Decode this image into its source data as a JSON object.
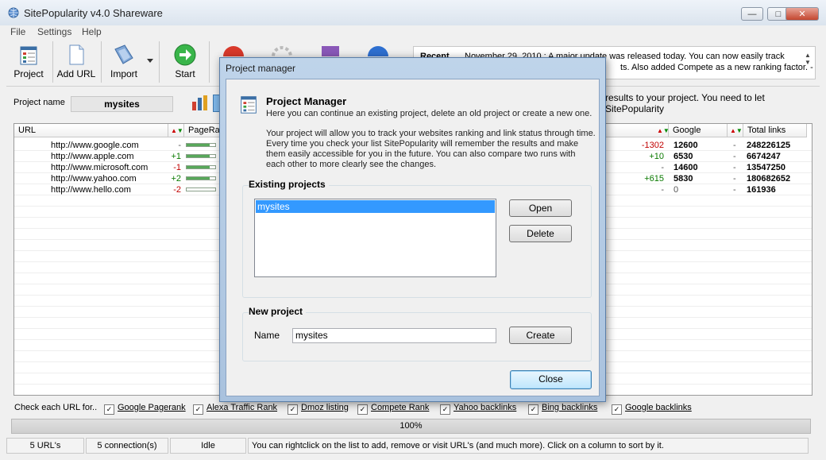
{
  "window": {
    "title": "SitePopularity v4.0 Shareware"
  },
  "menu": [
    "File",
    "Settings",
    "Help"
  ],
  "toolbar": {
    "project": "Project",
    "add_url": "Add URL",
    "import": "Import",
    "start": "Start"
  },
  "recent": {
    "label": "Recent",
    "line1": "November 29, 2010 : A major update was released today. You can now easily track",
    "line2": "ts. Also added Compete as a new ranking factor. -"
  },
  "project_row": {
    "label": "Project name",
    "value": "mysites",
    "hint": "results to your project. You need to let SitePopularity"
  },
  "grid": {
    "headers": {
      "url": "URL",
      "pagerank": "PageRa",
      "google": "Google",
      "total_links": "Total links"
    },
    "rows": [
      {
        "url": "http://www.google.com",
        "pr_change": "-",
        "pr_level": 0.8,
        "g_change": "-1302",
        "google": "12600",
        "tl_change": "-",
        "total_links": "248226125"
      },
      {
        "url": "http://www.apple.com",
        "pr_change": "+1",
        "pr_level": 0.8,
        "g_change": "+10",
        "google": "6530",
        "tl_change": "-",
        "total_links": "6674247"
      },
      {
        "url": "http://www.microsoft.com",
        "pr_change": "-1",
        "pr_level": 0.8,
        "g_change": "-",
        "google": "14600",
        "tl_change": "-",
        "total_links": "13547250"
      },
      {
        "url": "http://www.yahoo.com",
        "pr_change": "+2",
        "pr_level": 0.8,
        "g_change": "+615",
        "google": "5830",
        "tl_change": "-",
        "total_links": "180682652"
      },
      {
        "url": "http://www.hello.com",
        "pr_change": "-2",
        "pr_level": 0.0,
        "g_change": "-",
        "google": "0",
        "tl_change": "-",
        "total_links": "161936"
      }
    ]
  },
  "checks": {
    "label": "Check each URL for..",
    "items": [
      "Google Pagerank",
      "Alexa Traffic Rank",
      "Dmoz listing",
      "Compete Rank",
      "Yahoo backlinks",
      "Bing backlinks",
      "Google backlinks"
    ]
  },
  "progress": {
    "value": 1.0,
    "text": "100%"
  },
  "status": {
    "urls": "5 URL's",
    "connections": "5 connection(s)",
    "state": "Idle",
    "message": "You can rightclick on the list to add, remove or visit URL's (and much more). Click on a column to sort by it."
  },
  "modal": {
    "title": "Project manager",
    "heading": "Project Manager",
    "subheading": "Here you can continue an existing project, delete an old project or create a new one.",
    "description": "Your project will allow you to track your websites ranking and link status through time. Every time you check your list SitePopularity will remember the results and make them easily accessible for you in the future. You can also compare two runs with each other to more clearly see the changes.",
    "existing_title": "Existing projects",
    "projects": [
      "mysites"
    ],
    "open": "Open",
    "delete": "Delete",
    "new_title": "New project",
    "name_label": "Name",
    "name_value": "mysites",
    "create": "Create",
    "close": "Close"
  }
}
